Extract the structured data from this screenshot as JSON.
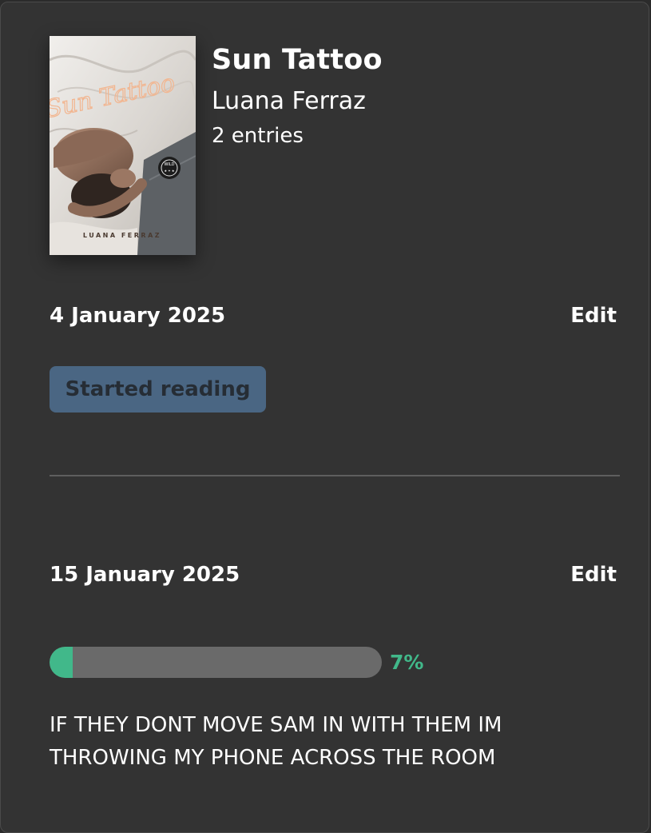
{
  "book": {
    "title": "Sun Tattoo",
    "author": "Luana Ferraz",
    "entries_count": "2 entries",
    "cover": {
      "script_title": "Sun Tattoo",
      "author_caption": "LUANA FERRAZ",
      "seal_text": "WILD"
    }
  },
  "entries": [
    {
      "date": "4 January 2025",
      "edit_label": "Edit",
      "status": "Started reading"
    },
    {
      "date": "15 January 2025",
      "edit_label": "Edit",
      "progress": 7,
      "progress_label": "7%",
      "note": "IF THEY DONT MOVE SAM IN WITH THEM IM THROWING MY PHONE ACROSS THE ROOM"
    }
  ],
  "colors": {
    "accent": "#41b88a",
    "badge_bg": "#4a6683",
    "card_bg": "#333333"
  }
}
